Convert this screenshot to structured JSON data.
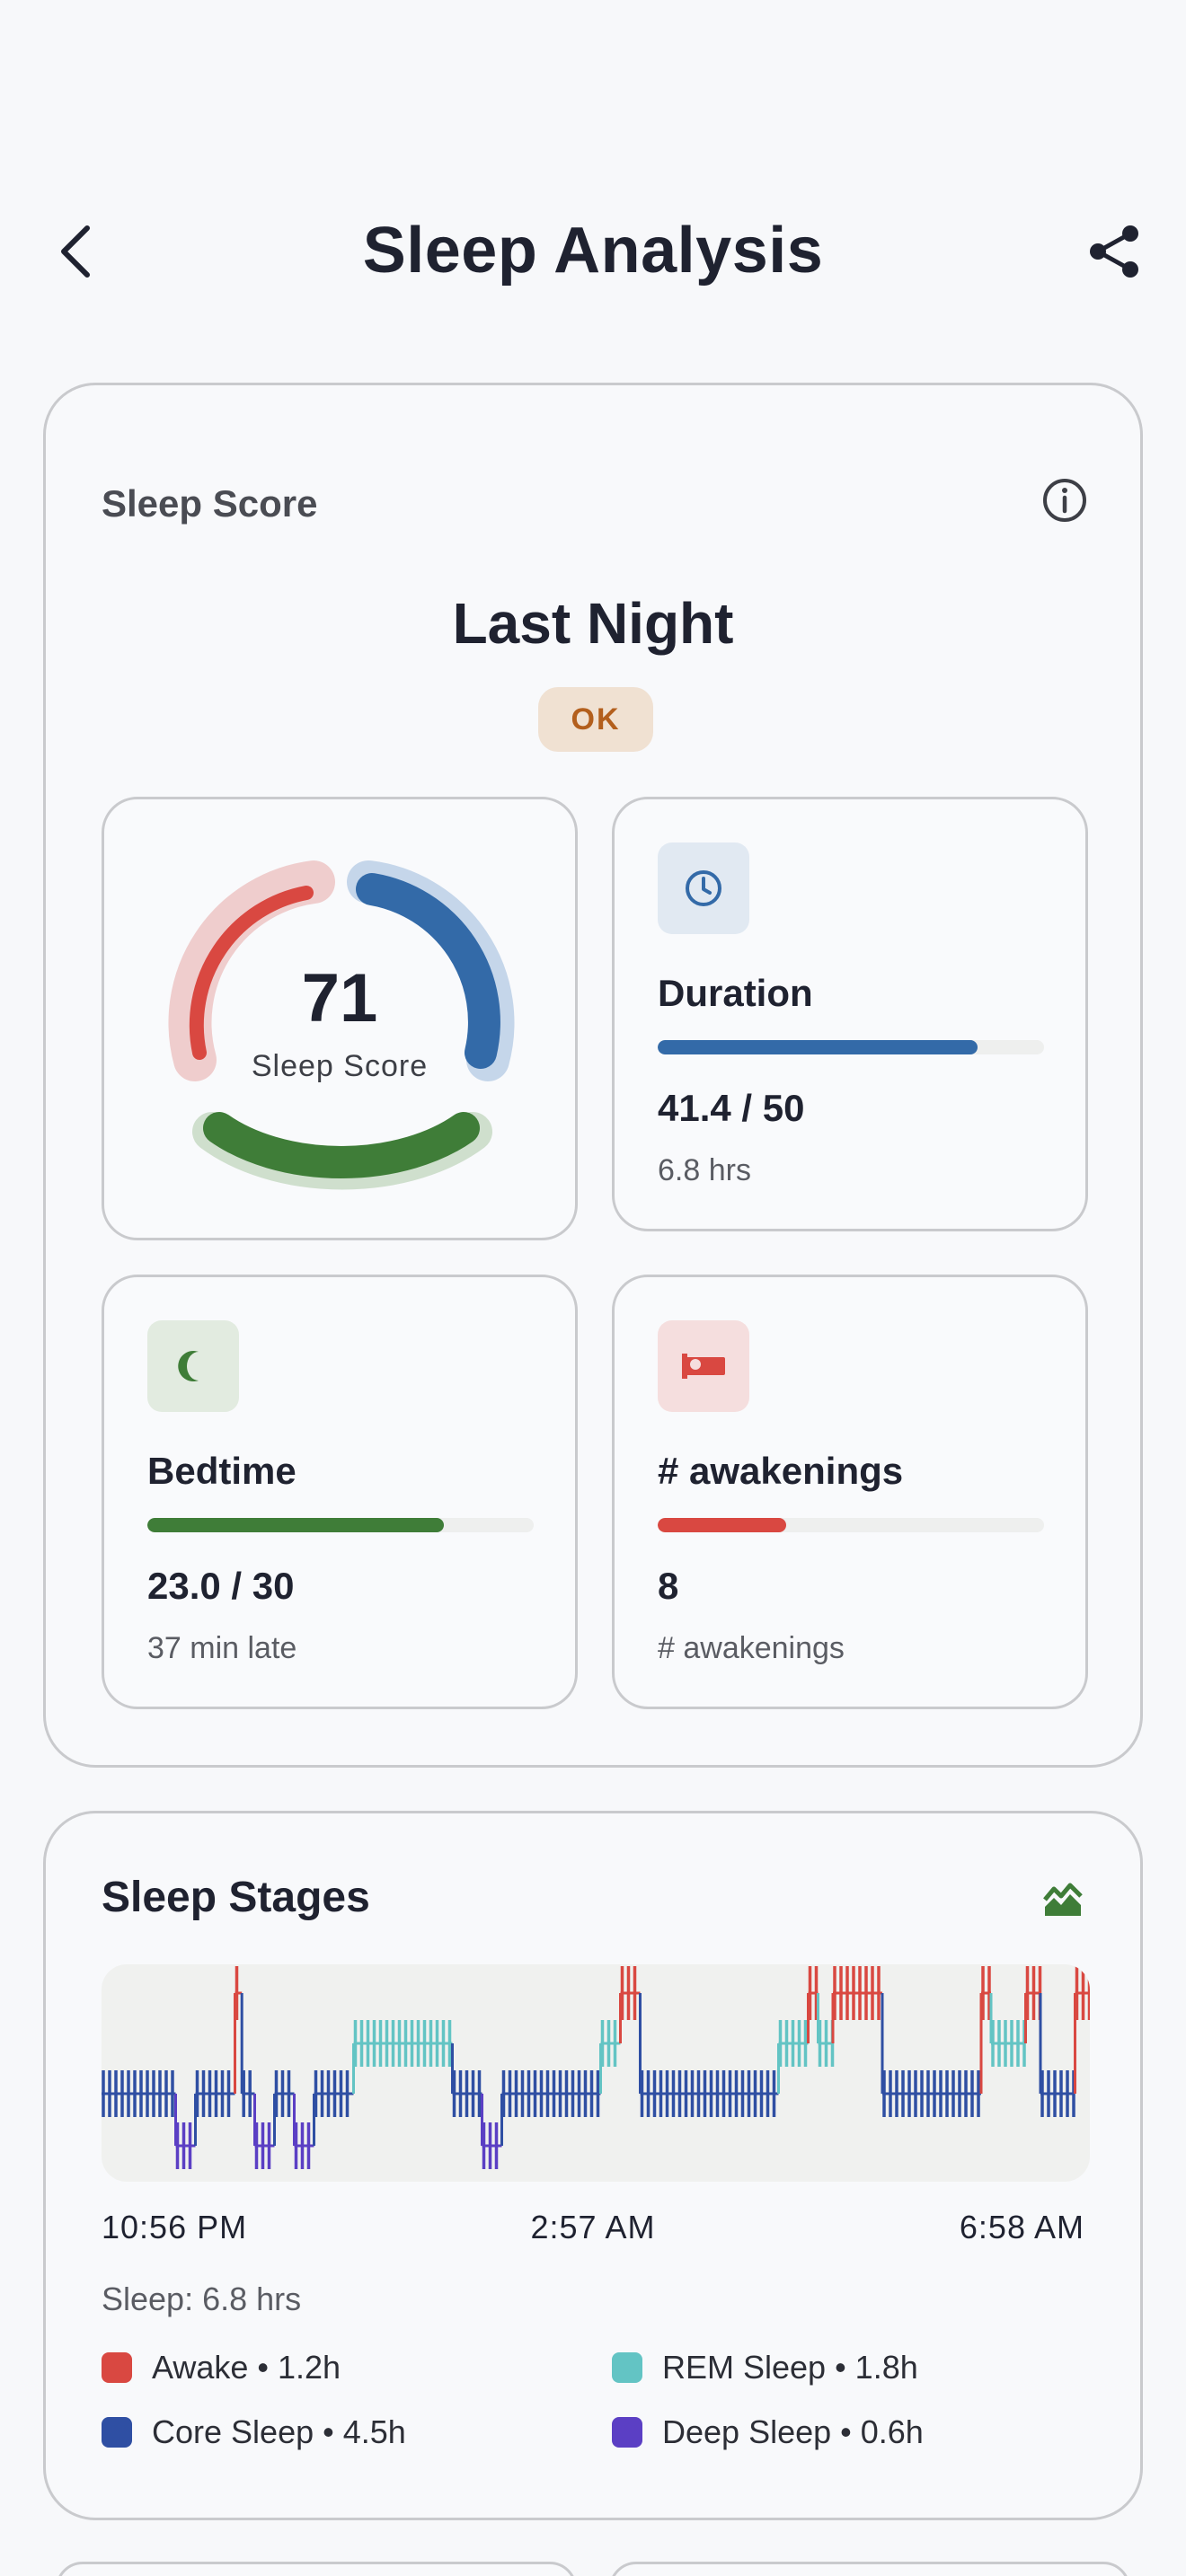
{
  "header": {
    "title": "Sleep Analysis",
    "back_icon": "chevron-left-icon",
    "share_icon": "share-icon"
  },
  "score_card": {
    "section_label": "Sleep Score",
    "info_icon": "info-icon",
    "period": "Last Night",
    "rating": "OK",
    "score": {
      "value": "71",
      "caption": "Sleep Score",
      "ring_colors": [
        "#d94841",
        "#336aa8",
        "#3f7d38"
      ]
    },
    "duration": {
      "title": "Duration",
      "value": "41.4 / 50",
      "sub": "6.8 hrs",
      "fraction": 0.828,
      "color": "#336aa8",
      "icon": "clock-icon"
    },
    "bedtime": {
      "title": "Bedtime",
      "value": "23.0 / 30",
      "sub": "37 min late",
      "fraction": 0.767,
      "color": "#3f7d38",
      "icon": "moon-icon"
    },
    "awakenings": {
      "title": "# awakenings",
      "value": "8",
      "sub": "# awakenings",
      "fraction": 0.333,
      "color": "#d94841",
      "icon": "bed-icon"
    }
  },
  "stages_card": {
    "title": "Sleep Stages",
    "icon": "chart-icon",
    "start_time": "10:56 PM",
    "mid_time": "2:57 AM",
    "end_time": "6:58 AM",
    "total": "Sleep: 6.8 hrs",
    "legend": [
      {
        "label": "Awake • 1.2h",
        "color": "#d94841"
      },
      {
        "label": "REM Sleep • 1.8h",
        "color": "#63c4c4"
      },
      {
        "label": "Core Sleep • 4.5h",
        "color": "#2f4fa3"
      },
      {
        "label": "Deep Sleep • 0.6h",
        "color": "#5b3fc4"
      }
    ]
  },
  "chart_data": {
    "type": "area",
    "title": "Sleep Stages",
    "x_start": "10:56 PM",
    "x_end": "6:58 AM",
    "levels": [
      "Awake",
      "REM Sleep",
      "Core Sleep",
      "Deep Sleep"
    ],
    "segments": [
      {
        "stage": "Core Sleep",
        "start": 0.0,
        "end": 0.075
      },
      {
        "stage": "Deep Sleep",
        "start": 0.075,
        "end": 0.095
      },
      {
        "stage": "Core Sleep",
        "start": 0.095,
        "end": 0.135
      },
      {
        "stage": "Awake",
        "start": 0.135,
        "end": 0.142
      },
      {
        "stage": "Core Sleep",
        "start": 0.142,
        "end": 0.155
      },
      {
        "stage": "Deep Sleep",
        "start": 0.155,
        "end": 0.175
      },
      {
        "stage": "Core Sleep",
        "start": 0.175,
        "end": 0.195
      },
      {
        "stage": "Deep Sleep",
        "start": 0.195,
        "end": 0.215
      },
      {
        "stage": "Core Sleep",
        "start": 0.215,
        "end": 0.255
      },
      {
        "stage": "REM Sleep",
        "start": 0.255,
        "end": 0.355
      },
      {
        "stage": "Core Sleep",
        "start": 0.355,
        "end": 0.385
      },
      {
        "stage": "Deep Sleep",
        "start": 0.385,
        "end": 0.405
      },
      {
        "stage": "Core Sleep",
        "start": 0.405,
        "end": 0.505
      },
      {
        "stage": "REM Sleep",
        "start": 0.505,
        "end": 0.525
      },
      {
        "stage": "Awake",
        "start": 0.525,
        "end": 0.545
      },
      {
        "stage": "Core Sleep",
        "start": 0.545,
        "end": 0.685
      },
      {
        "stage": "REM Sleep",
        "start": 0.685,
        "end": 0.715
      },
      {
        "stage": "Awake",
        "start": 0.715,
        "end": 0.725
      },
      {
        "stage": "REM Sleep",
        "start": 0.725,
        "end": 0.74
      },
      {
        "stage": "Awake",
        "start": 0.74,
        "end": 0.79
      },
      {
        "stage": "Core Sleep",
        "start": 0.79,
        "end": 0.89
      },
      {
        "stage": "Awake",
        "start": 0.89,
        "end": 0.9
      },
      {
        "stage": "REM Sleep",
        "start": 0.9,
        "end": 0.935
      },
      {
        "stage": "Awake",
        "start": 0.935,
        "end": 0.95
      },
      {
        "stage": "Core Sleep",
        "start": 0.95,
        "end": 0.985
      },
      {
        "stage": "Awake",
        "start": 0.985,
        "end": 1.0
      }
    ]
  }
}
